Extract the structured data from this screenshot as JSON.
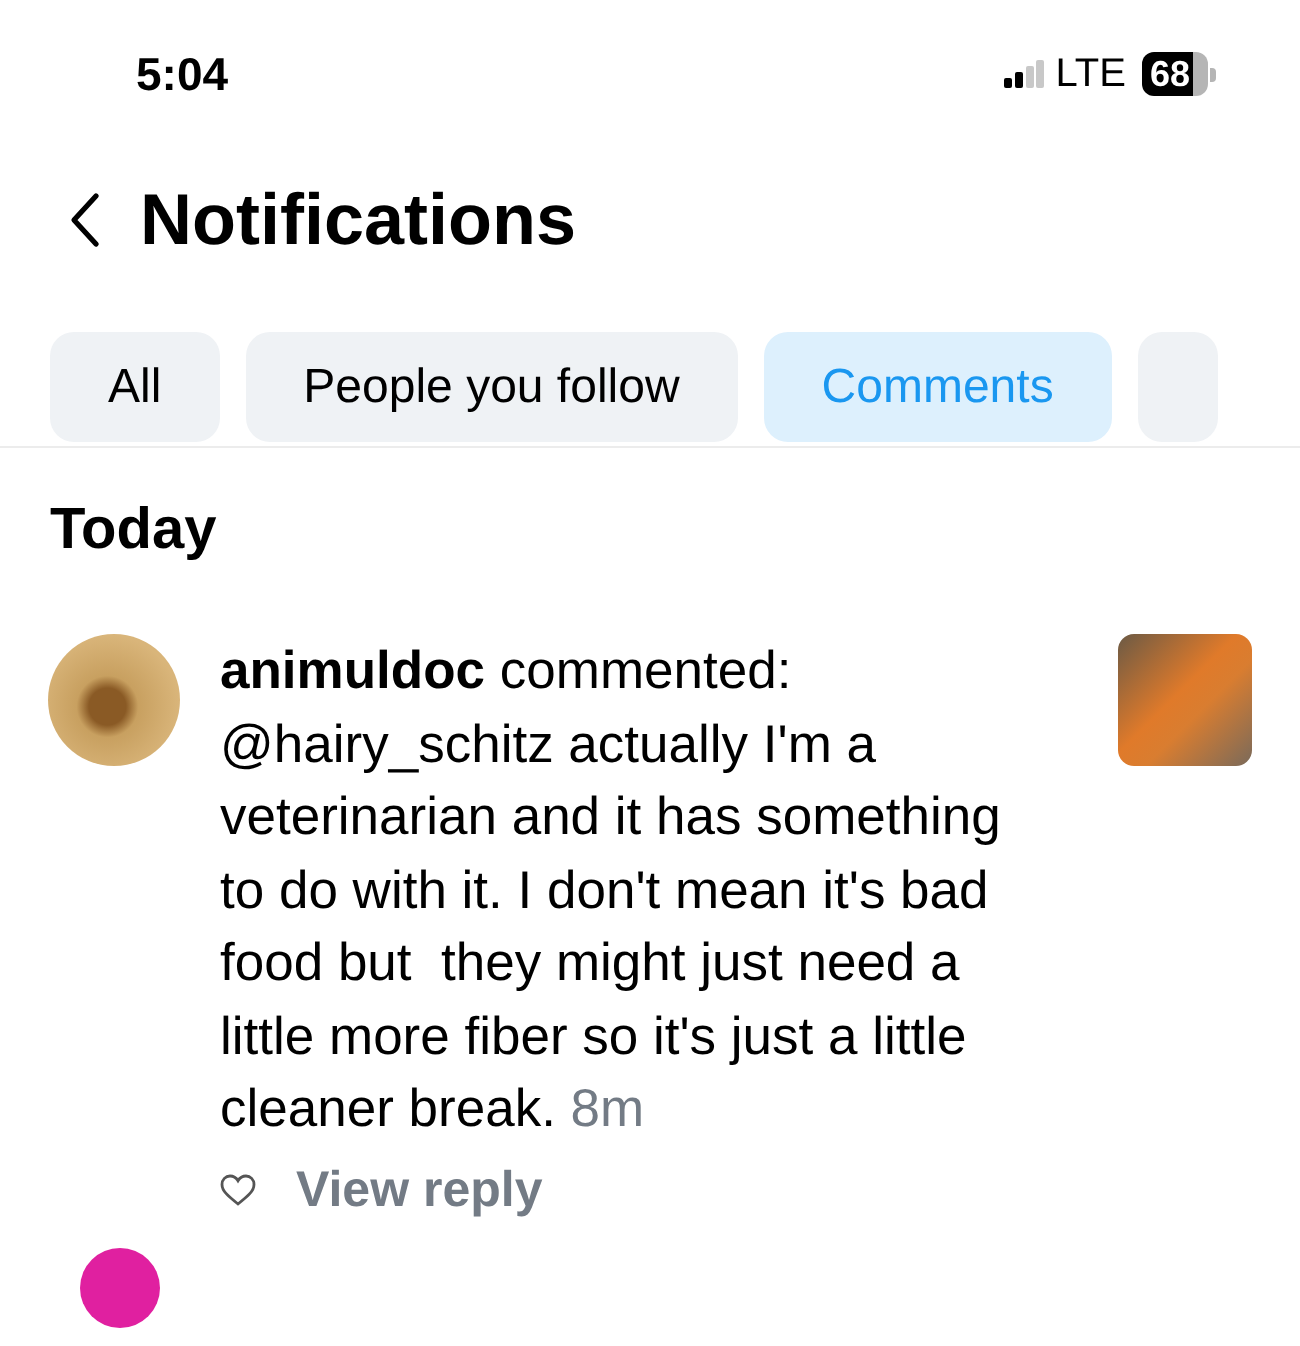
{
  "status_bar": {
    "time": "5:04",
    "network": "LTE",
    "battery": "68"
  },
  "header": {
    "title": "Notifications"
  },
  "tabs": [
    {
      "label": "All",
      "selected": false
    },
    {
      "label": "People you follow",
      "selected": false
    },
    {
      "label": "Comments",
      "selected": true
    }
  ],
  "section": "Today",
  "notifications": [
    {
      "text": "**animuldoc** commented: @hairy_schitz actually I'm a veterinarian and it has something to do with it. I don't mean it's bad food but  they might just need a little more fiber so it's just a little cleaner break.",
      "time": "8m",
      "action": "View reply"
    }
  ]
}
